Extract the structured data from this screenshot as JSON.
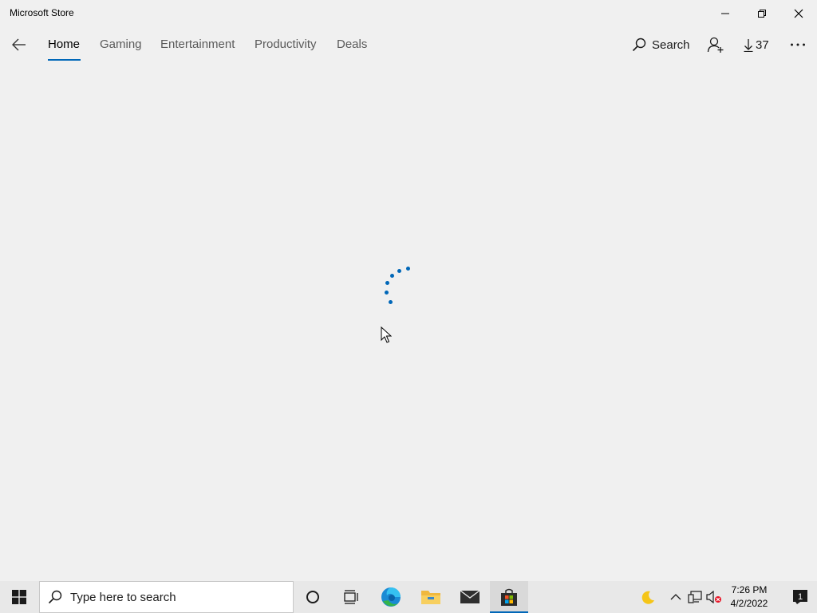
{
  "window": {
    "title": "Microsoft Store"
  },
  "nav": {
    "tabs": [
      {
        "label": "Home",
        "active": true
      },
      {
        "label": "Gaming"
      },
      {
        "label": "Entertainment"
      },
      {
        "label": "Productivity"
      },
      {
        "label": "Deals"
      }
    ],
    "search_label": "Search",
    "downloads_count": "37"
  },
  "content": {
    "state": "loading"
  },
  "taskbar": {
    "search_placeholder": "Type here to search",
    "clock_time": "7:26 PM",
    "clock_date": "4/2/2022",
    "notification_count": "1"
  },
  "colors": {
    "accent": "#0067b8",
    "background": "#f0f0f0",
    "taskbar": "#e8e8e8"
  }
}
